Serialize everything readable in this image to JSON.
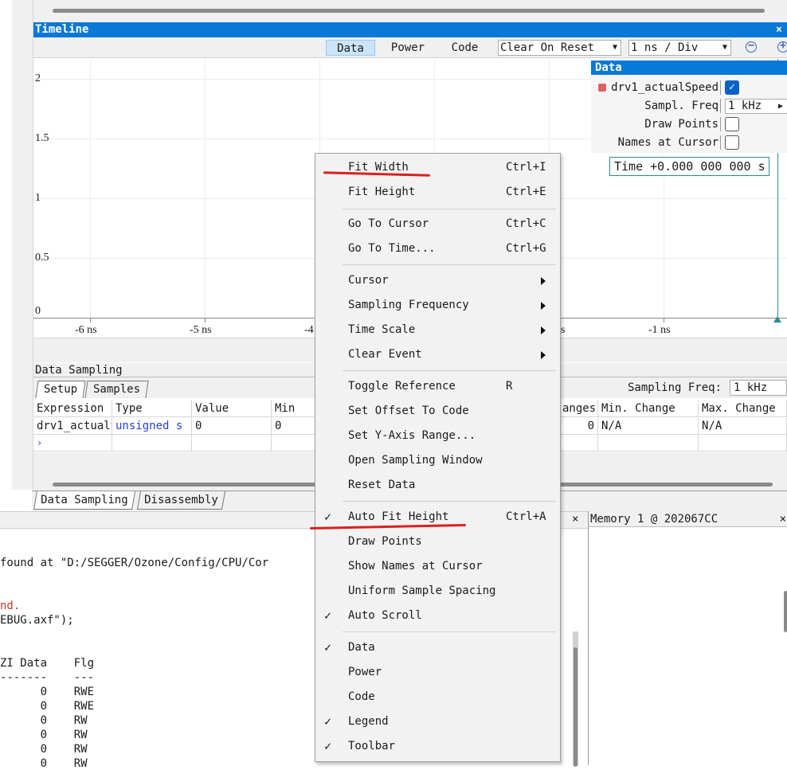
{
  "timeline": {
    "title": "Timeline",
    "close": "×",
    "toolbar": {
      "data": "Data",
      "power": "Power",
      "code": "Code",
      "clear_on_reset": "Clear On Reset",
      "time_per_div": "1 ns / Div",
      "zoom_out_icon": "minus-circle",
      "zoom_in_icon": "plus-circle"
    },
    "y_labels": [
      "2",
      "1.5",
      "1",
      "0.5",
      "0"
    ],
    "x_labels": [
      "-6 ns",
      "-5 ns",
      "-4",
      "s",
      "-1 ns"
    ]
  },
  "legend": {
    "title": "Data",
    "series_name": "drv1_actualSpeed",
    "series_color": "#e06060",
    "series_checked": true,
    "sampl_freq_label": "Sampl. Freq",
    "sampl_freq_value": "1 kHz",
    "draw_points_label": "Draw Points",
    "names_at_cursor_label": "Names at Cursor",
    "check_mark": "✓"
  },
  "time_readout": "Time +0.000 000 000 s",
  "data_sampling": {
    "title": "Data Sampling",
    "tabs": [
      "Setup",
      "Samples"
    ],
    "sampling_freq_label": "Sampling Freq:",
    "sampling_freq_value": "1 kHz",
    "columns": [
      "Expression",
      "Type",
      "Value",
      "Min",
      "anges",
      "Min. Change",
      "Max. Change"
    ],
    "row": [
      "drv1_actualS",
      "unsigned s",
      "0",
      "0",
      "0",
      "N/A",
      "N/A"
    ],
    "new_row_marker": "›"
  },
  "bottom_tabs": [
    "Data Sampling",
    "Disassembly"
  ],
  "console": {
    "close": "×",
    "lines": [
      "found at \"D:/SEGGER/Ozone/Config/CPU/Cor",
      "nd.",
      "EBUG.axf\");",
      "ZI Data    Flg",
      "-------    ---",
      "      0    RWE",
      "      0    RWE",
      "      0    RW",
      "      0    RW",
      "      0    RW",
      "      0    RW"
    ]
  },
  "memory": {
    "title": "Memory 1 @ 202067CC",
    "close": "×"
  },
  "context_menu": {
    "check": "✓",
    "items": [
      {
        "label": "Fit Width",
        "shortcut": "Ctrl+I"
      },
      {
        "label": "Fit Height",
        "shortcut": "Ctrl+E"
      },
      {
        "label": "Go To Cursor",
        "shortcut": "Ctrl+C"
      },
      {
        "label": "Go To Time...",
        "shortcut": "Ctrl+G"
      },
      {
        "label": "Cursor",
        "shortcut": ""
      },
      {
        "label": "Sampling Frequency",
        "shortcut": ""
      },
      {
        "label": "Time Scale",
        "shortcut": ""
      },
      {
        "label": "Clear Event",
        "shortcut": ""
      },
      {
        "label": "Toggle Reference",
        "shortcut": "R"
      },
      {
        "label": "Set Offset To Code",
        "shortcut": ""
      },
      {
        "label": "Set Y-Axis Range...",
        "shortcut": ""
      },
      {
        "label": "Open Sampling Window",
        "shortcut": ""
      },
      {
        "label": "Reset Data",
        "shortcut": ""
      },
      {
        "label": "Auto Fit Height",
        "shortcut": "Ctrl+A"
      },
      {
        "label": "Draw Points",
        "shortcut": ""
      },
      {
        "label": "Show Names at Cursor",
        "shortcut": ""
      },
      {
        "label": "Uniform Sample Spacing",
        "shortcut": ""
      },
      {
        "label": "Auto Scroll",
        "shortcut": ""
      },
      {
        "label": "Data",
        "shortcut": ""
      },
      {
        "label": "Power",
        "shortcut": ""
      },
      {
        "label": "Code",
        "shortcut": ""
      },
      {
        "label": "Legend",
        "shortcut": ""
      },
      {
        "label": "Toolbar",
        "shortcut": ""
      }
    ]
  },
  "annotation_color": "#d92020"
}
